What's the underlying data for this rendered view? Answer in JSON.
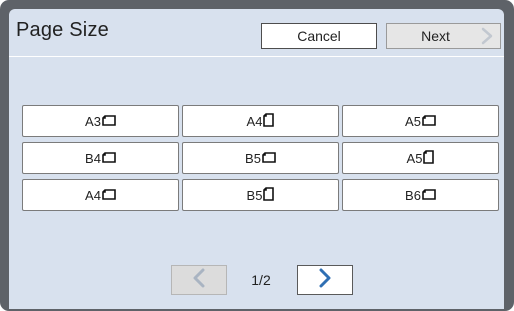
{
  "header": {
    "title": "Page Size",
    "cancel_label": "Cancel",
    "next_label": "Next"
  },
  "sizes": [
    {
      "label": "A3",
      "orientation": "landscape"
    },
    {
      "label": "A4",
      "orientation": "portrait"
    },
    {
      "label": "A5",
      "orientation": "landscape"
    },
    {
      "label": "B4",
      "orientation": "landscape"
    },
    {
      "label": "B5",
      "orientation": "landscape"
    },
    {
      "label": "A5",
      "orientation": "portrait"
    },
    {
      "label": "A4",
      "orientation": "landscape"
    },
    {
      "label": "B5",
      "orientation": "portrait"
    },
    {
      "label": "B6",
      "orientation": "landscape"
    }
  ],
  "pager": {
    "indicator": "1/2",
    "prev_icon": "chevron-left-icon",
    "next_icon": "chevron-right-icon"
  },
  "colors": {
    "panel_bg": "#d8e1ee",
    "frame": "#5e6268",
    "chevron_active": "#2f6fb3",
    "chevron_disabled": "#a9b4c2"
  }
}
